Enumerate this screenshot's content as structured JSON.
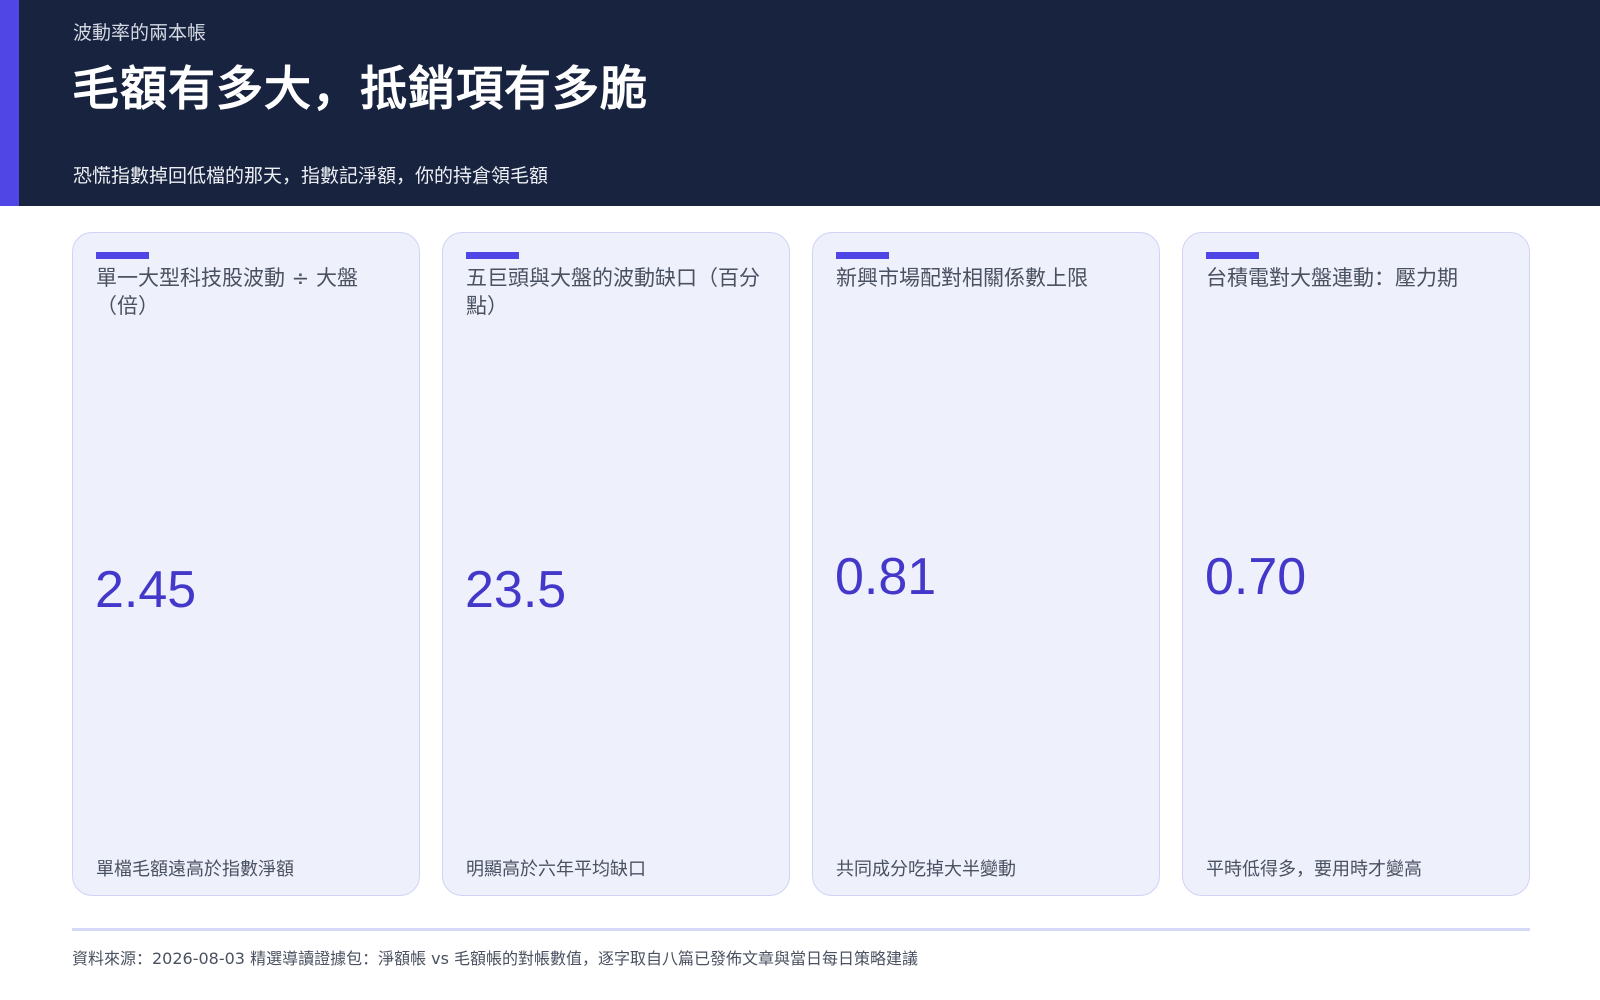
{
  "header": {
    "eyebrow": "波動率的兩本帳",
    "title": "毛額有多大，抵銷項有多脆",
    "subtitle": "恐慌指數掉回低檔的那天，指數記淨額，你的持倉領毛額"
  },
  "cards": [
    {
      "label": "單一大型科技股波動 ÷ 大盤（倍）",
      "value": "2.45",
      "note": "單檔毛額遠高於指數淨額"
    },
    {
      "label": "五巨頭與大盤的波動缺口（百分點）",
      "value": "23.5",
      "note": "明顯高於六年平均缺口"
    },
    {
      "label": "新興市場配對相關係數上限",
      "value": "0.81",
      "note": "共同成分吃掉大半變動"
    },
    {
      "label": "台積電對大盤連動：壓力期",
      "value": "0.70",
      "note": "平時低得多，要用時才變高"
    }
  ],
  "footer": {
    "source": "資料來源：2026-08-03 精選導讀證據包：淨額帳 vs 毛額帳的對帳數值，逐字取自八篇已發佈文章與當日每日策略建議"
  },
  "colors": {
    "header_bg": "#17233f",
    "accent": "#4f46e5",
    "card_bg": "#eef0fc",
    "value_color": "#4338ca"
  }
}
